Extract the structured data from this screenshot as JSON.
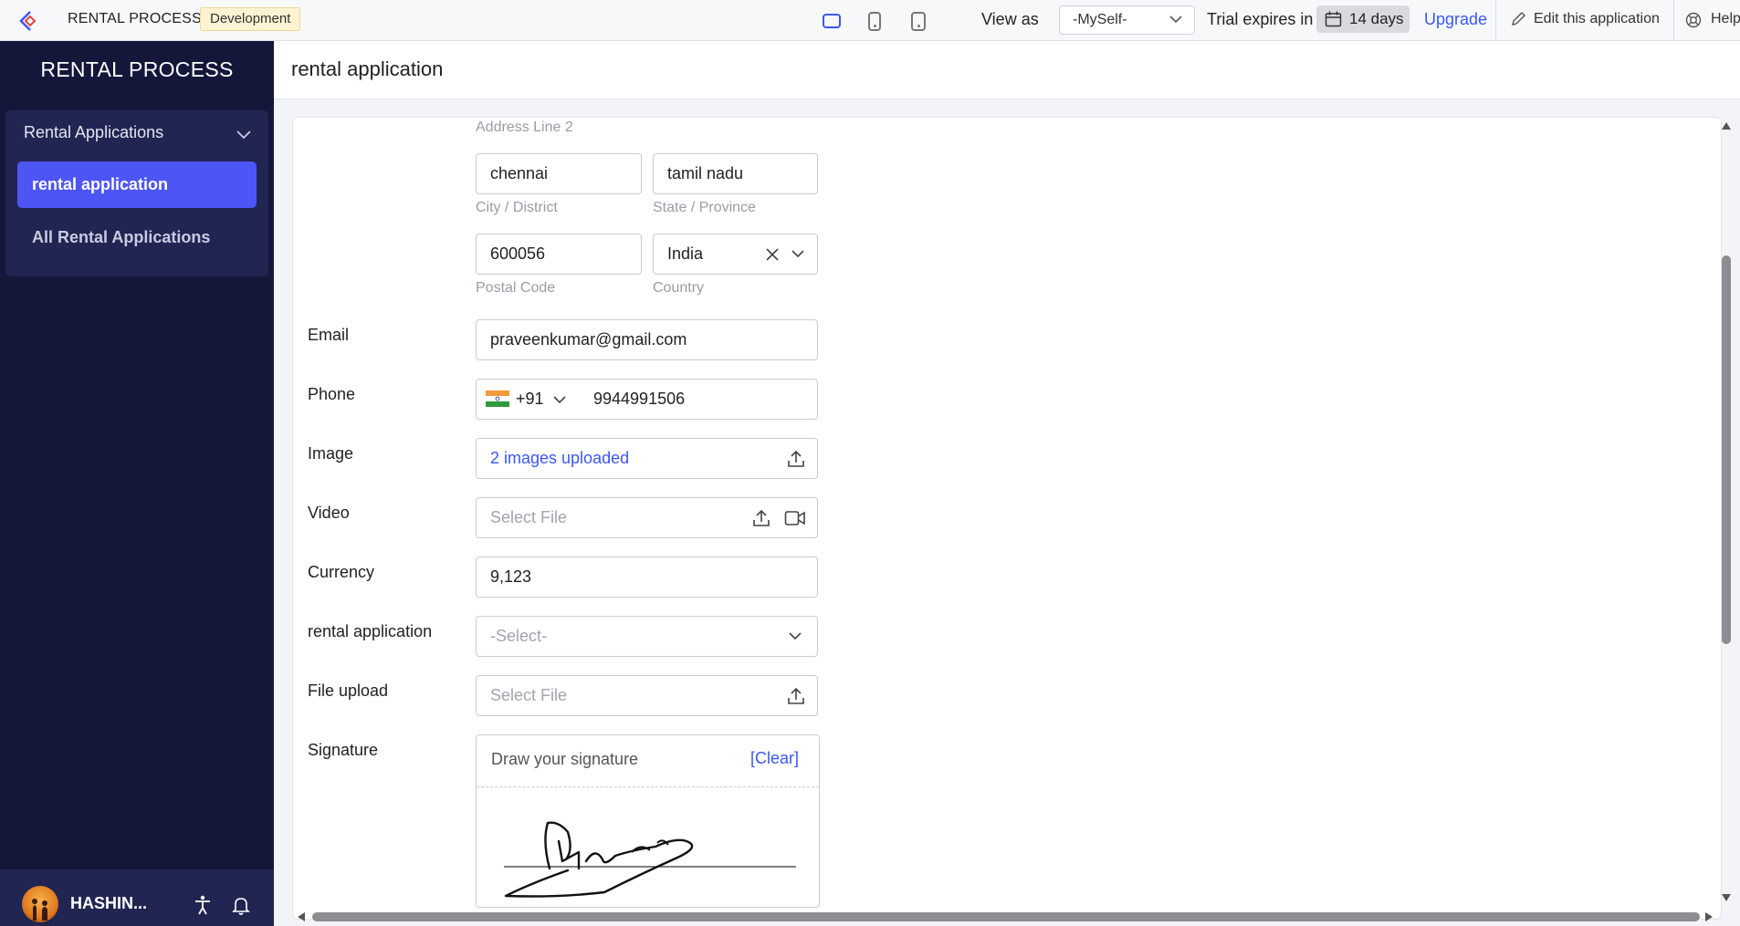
{
  "topbar": {
    "app_name": "RENTAL PROCESS",
    "env_badge": "Development",
    "view_as_label": "View as",
    "view_as_value": "-MySelf-",
    "trial_label": "Trial expires in",
    "trial_days": "14 days",
    "upgrade_label": "Upgrade",
    "edit_label": "Edit this application",
    "help_label": "Help",
    "accent_color": "#3b57f5"
  },
  "sidebar": {
    "title": "RENTAL PROCESS",
    "group_label": "Rental Applications",
    "items": [
      {
        "label": "rental application",
        "active": true
      },
      {
        "label": "All Rental Applications",
        "active": false
      }
    ],
    "user_name": "HASHIN...",
    "background": "#14173a",
    "active_color": "#4e55f5"
  },
  "page": {
    "title": "rental application"
  },
  "form": {
    "address_line2_label": "Address Line 2",
    "city_value": "chennai",
    "city_label": "City / District",
    "state_value": "tamil nadu",
    "state_label": "State / Province",
    "postal_value": "600056",
    "postal_label": "Postal Code",
    "country_value": "India",
    "country_label": "Country",
    "email_label": "Email",
    "email_value": "praveenkumar@gmail.com",
    "phone_label": "Phone",
    "phone_code": "+91",
    "phone_value": "9944991506",
    "image_label": "Image",
    "image_value": "2 images uploaded",
    "video_label": "Video",
    "video_placeholder": "Select File",
    "currency_label": "Currency",
    "currency_value": "9,123",
    "rental_app_label": "rental application",
    "rental_app_placeholder": "-Select-",
    "file_upload_label": "File upload",
    "file_upload_placeholder": "Select File",
    "signature_label": "Signature",
    "signature_prompt": "Draw your signature",
    "signature_clear": "[Clear]"
  }
}
